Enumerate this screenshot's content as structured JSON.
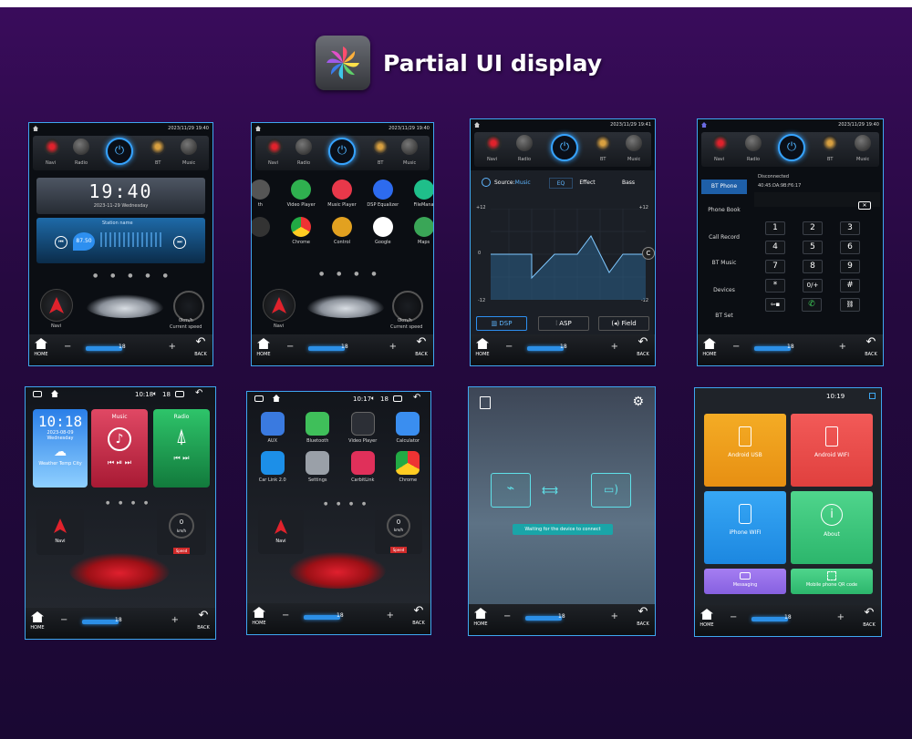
{
  "header": {
    "title": "Partial UI display",
    "logo_icon": "pinwheel-icon"
  },
  "colors": {
    "accent": "#3ea7f0",
    "bg": "#2a0a45"
  },
  "common": {
    "dock_labels": [
      "Navi",
      "Radio",
      "BT",
      "Music"
    ],
    "home_label": "HOME",
    "back_label": "BACK",
    "volume_value": "18",
    "minus": "−",
    "plus": "+"
  },
  "screen1": {
    "status_time": "2023/11/29 19:40",
    "clock": "19:40",
    "date": "2023-11-29",
    "weekday": "Wednesday",
    "station_name": "Station name",
    "frequency": "87.50",
    "navi": "Navi",
    "speed_value": "0km/h",
    "speed_label": "Current speed"
  },
  "screen2": {
    "status_time": "2023/11/29 19:40",
    "apps": [
      {
        "label": "th"
      },
      {
        "label": "Video Player"
      },
      {
        "label": "Music Player"
      },
      {
        "label": "DSP Equalizer"
      },
      {
        "label": "FileMana"
      },
      {
        "label": ""
      },
      {
        "label": "Chrome"
      },
      {
        "label": "Control"
      },
      {
        "label": "Google"
      },
      {
        "label": "Maps"
      }
    ],
    "navi": "Navi",
    "speed_value": "0km/h",
    "speed_label": "Current speed"
  },
  "screen3": {
    "status_time": "2023/11/29 19:41",
    "source_label": "Source:",
    "source_value": "Music",
    "tabs": [
      "EQ",
      "Effect",
      "Bass"
    ],
    "y_top": "+12",
    "y_zero": "0",
    "y_bottom": "-12",
    "buttons": [
      "DSP",
      "ASP",
      "Field"
    ],
    "side_button": "C"
  },
  "screen4": {
    "status_time": "2023/11/29 19:40",
    "status": "Disconnected",
    "mac": "40:45:DA:9B:F6:17",
    "menu": [
      "BT Phone",
      "Phone Book",
      "Call Record",
      "BT Music",
      "Devices",
      "BT Set"
    ],
    "keys": [
      "1",
      "2",
      "3",
      "4",
      "5",
      "6",
      "7",
      "8",
      "9",
      "*",
      "0/+",
      "#"
    ]
  },
  "screen5": {
    "time": "10:18",
    "volume": "18",
    "clock": "10:18",
    "date": "2023-08-09",
    "weekday": "Wednesday",
    "weather_labels": "Weather  Temp  City",
    "music_title": "Music",
    "radio_title": "Radio",
    "navi": "Navi",
    "speed_value": "0",
    "speed_unit": "km/h",
    "speed_label": "Speed"
  },
  "screen6": {
    "time": "10:17",
    "volume": "18",
    "apps": [
      "AUX",
      "Bluetooth",
      "Video Player",
      "Calculator",
      "Car Link 2.0",
      "Settings",
      "CarbitLink",
      "Chrome"
    ],
    "navi": "Navi",
    "speed_value": "0",
    "speed_unit": "km/h",
    "speed_label": "Speed"
  },
  "screen7": {
    "connect_message": "Waiting for the device to connect"
  },
  "screen8": {
    "time": "10:19",
    "tiles": [
      "Android USB",
      "Android WIFI",
      "iPhone WIFI",
      "About",
      "Messaging",
      "Mobile phone QR code"
    ]
  }
}
